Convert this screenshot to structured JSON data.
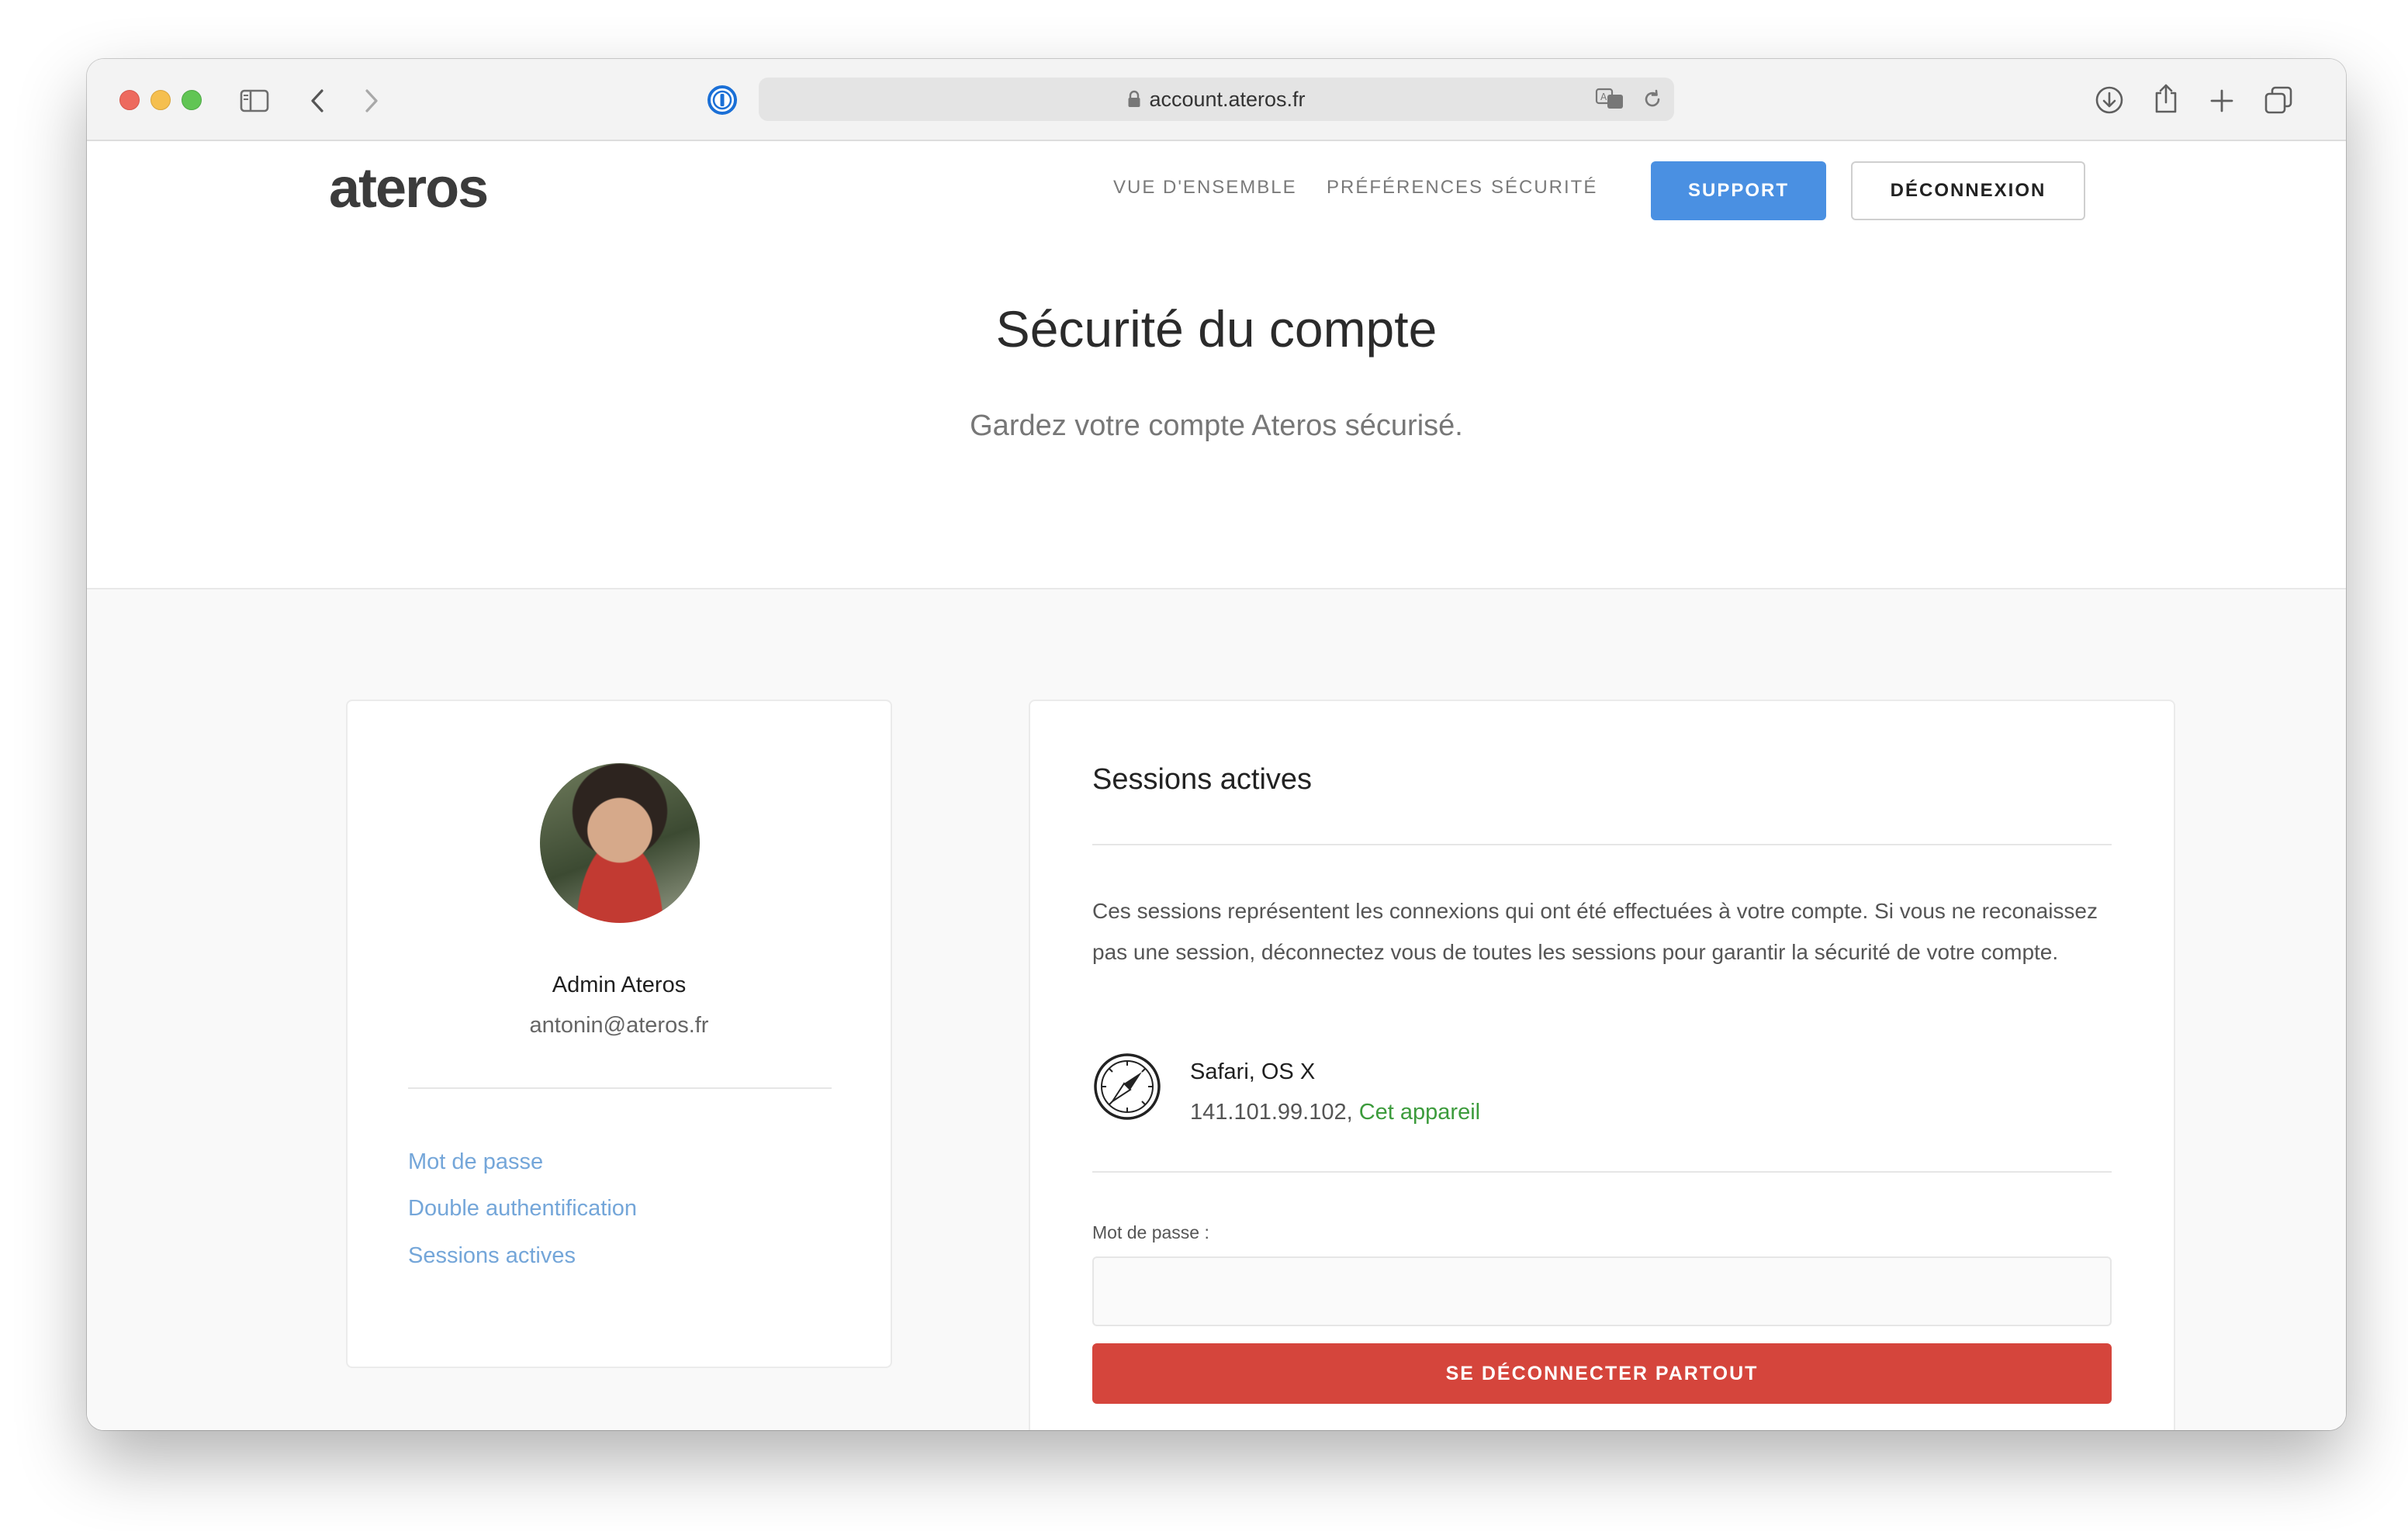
{
  "browser": {
    "url": "account.ateros.fr"
  },
  "nav": {
    "logo": "ateros",
    "links": [
      "VUE D'ENSEMBLE",
      "PRÉFÉRENCES",
      "SÉCURITÉ"
    ],
    "support_label": "SUPPORT",
    "logout_label": "DÉCONNEXION"
  },
  "hero": {
    "title": "Sécurité du compte",
    "subtitle": "Gardez votre compte Ateros sécurisé."
  },
  "profile": {
    "name": "Admin Ateros",
    "email": "antonin@ateros.fr",
    "links": [
      "Mot de passe",
      "Double authentification",
      "Sessions actives"
    ]
  },
  "sessions": {
    "title": "Sessions actives",
    "description": "Ces sessions représentent les connexions qui ont été effectuées à votre compte. Si vous ne reconaissez pas une session, déconnectez vous de toutes les sessions pour garantir la sécurité de votre compte.",
    "items": [
      {
        "name": "Safari, OS X",
        "ip": "141.101.99.102,",
        "current_label": "Cet appareil",
        "icon": "safari-compass-icon"
      }
    ],
    "password_label": "Mot de passe :",
    "password_value": "",
    "logout_all_label": "SE DÉCONNECTER PARTOUT"
  },
  "colors": {
    "primary": "#4a90e2",
    "danger": "#d5453c",
    "link": "#74a6d9",
    "success": "#3c9b3c"
  }
}
